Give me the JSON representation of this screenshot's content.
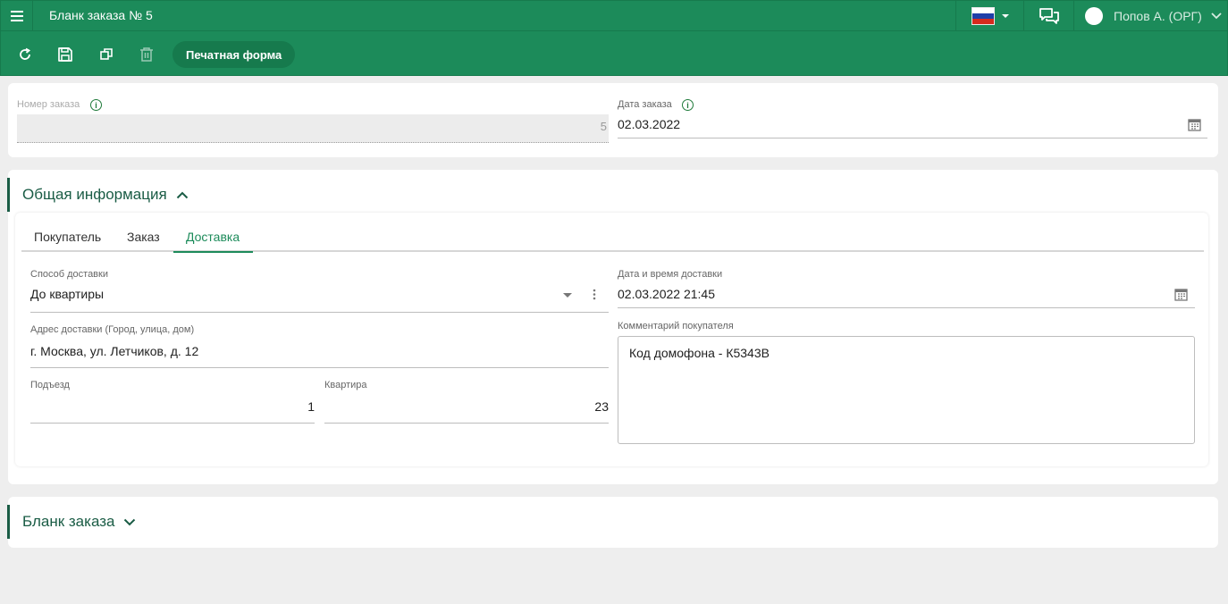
{
  "app": {
    "title": "Бланк заказа № 5"
  },
  "user": {
    "name": "Попов А. (ОРГ)"
  },
  "colors": {
    "brand": "#1c8b5a",
    "accent": "#1a5c45"
  },
  "icons": {
    "menu": "menu-icon",
    "refresh": "refresh-icon",
    "save": "save-icon",
    "copy": "copy-icon",
    "delete": "trash-icon",
    "chat": "chat-icon",
    "flag": "russia-flag-icon",
    "calendar": "calendar-icon",
    "info": "info-icon"
  },
  "toolbar": {
    "print_label": "Печатная форма"
  },
  "header_fields": {
    "order_number": {
      "label": "Номер заказа",
      "value": "5"
    },
    "order_date": {
      "label": "Дата заказа",
      "value": "02.03.2022"
    }
  },
  "general_section": {
    "title": "Общая информация",
    "tabs": [
      {
        "label": "Покупатель"
      },
      {
        "label": "Заказ"
      },
      {
        "label": "Доставка"
      }
    ],
    "delivery": {
      "method": {
        "label": "Способ доставки",
        "value": "До квартиры"
      },
      "datetime": {
        "label": "Дата и время доставки",
        "value": "02.03.2022 21:45"
      },
      "address": {
        "label": "Адрес доставки (Город, улица, дом)",
        "value": "г. Москва, ул. Летчиков, д. 12"
      },
      "comment": {
        "label": "Комментарий покупателя",
        "value": "Код домофона - К5343В"
      },
      "entrance": {
        "label": "Подъезд",
        "value": "1"
      },
      "apartment": {
        "label": "Квартира",
        "value": "23"
      }
    }
  },
  "order_form_section": {
    "title": "Бланк заказа"
  }
}
